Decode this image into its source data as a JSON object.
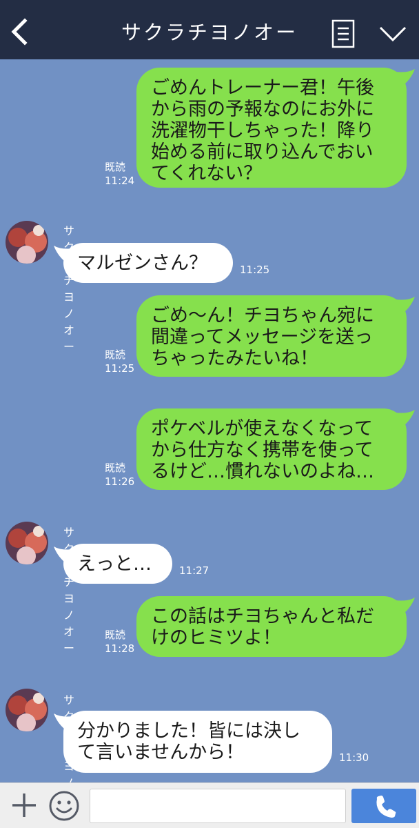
{
  "header": {
    "title": "サクラチヨノオー",
    "background": "#232d44"
  },
  "theme": {
    "chat_background": "#7191c4",
    "outgoing_bubble": "#86e04d",
    "incoming_bubble": "#ffffff",
    "send_button": "#4b85db"
  },
  "messages": [
    {
      "direction": "out",
      "lines": [
        "ごめんトレーナー君！午後",
        "から雨の予報なのにお外に",
        "洗濯物干しちゃった！降り",
        "始める前に取り込んでおい",
        "てくれない？"
      ],
      "read": "既読",
      "time": "11:24"
    },
    {
      "direction": "in",
      "sender": "サクラチヨノオー",
      "lines": [
        "マルゼンさん？"
      ],
      "time": "11:25"
    },
    {
      "direction": "out",
      "lines": [
        "ごめ〜ん！チヨちゃん宛に",
        "間違ってメッセージを送っ",
        "ちゃったみたいね！"
      ],
      "read": "既読",
      "time": "11:25"
    },
    {
      "direction": "out",
      "lines": [
        "ポケベルが使えなくなって",
        "から仕方なく携帯を使って",
        "るけど…慣れないのよね…"
      ],
      "read": "既読",
      "time": "11:26"
    },
    {
      "direction": "in",
      "sender": "サクラチヨノオー",
      "lines": [
        "えっと…"
      ],
      "time": "11:27"
    },
    {
      "direction": "out",
      "lines": [
        "この話はチヨちゃんと私だ",
        "けのヒミツよ！"
      ],
      "read": "既読",
      "time": "11:28"
    },
    {
      "direction": "in",
      "sender": "サクラチヨノオー",
      "lines": [
        "分かりました！皆には決し",
        "て言いませんから！"
      ],
      "time": "11:30"
    }
  ],
  "footer": {
    "input_value": "",
    "icons": [
      "plus-icon",
      "smiley-icon",
      "phone-icon"
    ]
  }
}
